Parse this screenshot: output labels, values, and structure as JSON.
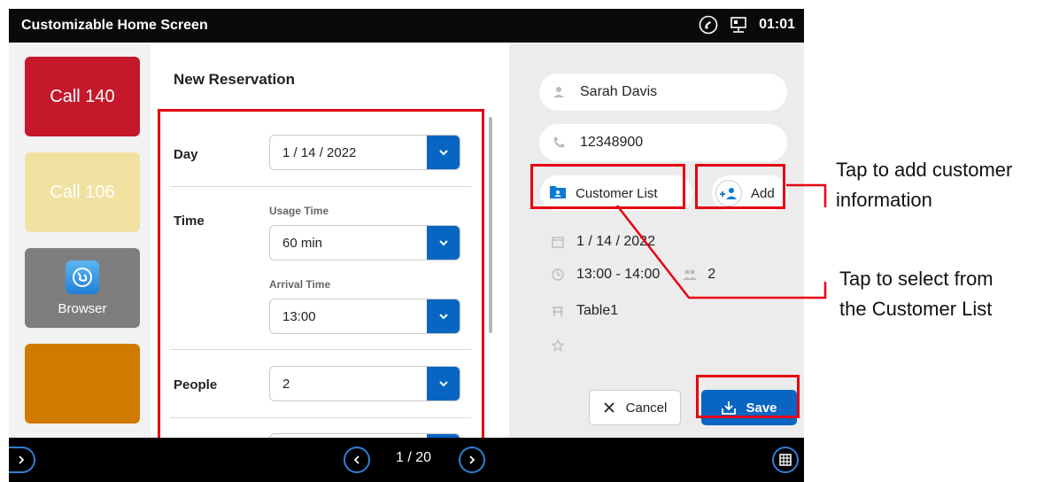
{
  "titlebar": {
    "title": "Customizable Home Screen",
    "time": "01:01"
  },
  "tiles": [
    {
      "label": "Call 140",
      "color": "#c5182b"
    },
    {
      "label": "Call 106",
      "color": "#f1e2a2"
    },
    {
      "label": "Browser",
      "color": "#7e7e7e"
    },
    {
      "label": "",
      "color": "#d07a00"
    }
  ],
  "form": {
    "title": "New Reservation",
    "day_label": "Day",
    "day_value": "1 / 14 / 2022",
    "time_label": "Time",
    "usage_time_label": "Usage Time",
    "usage_time_value": "60 min",
    "arrival_time_label": "Arrival Time",
    "arrival_time_value": "13:00",
    "people_label": "People",
    "people_value": "2"
  },
  "customer": {
    "name": "Sarah Davis",
    "phone": "12348900",
    "customer_list_label": "Customer List",
    "add_label": "Add",
    "date": "1 / 14 / 2022",
    "time_range": "13:00 - 14:00",
    "people": "2",
    "table": "Table1"
  },
  "actions": {
    "cancel_label": "Cancel",
    "save_label": "Save"
  },
  "pager": {
    "indicator": "1 / 20"
  },
  "annotations": {
    "add_info": [
      "Tap to add customer",
      "information"
    ],
    "select_list": [
      "Tap to select from",
      "the Customer List"
    ]
  },
  "colors": {
    "accent": "#0866c2",
    "highlight": "#e60012",
    "titlebar": "#0a0a0a"
  }
}
